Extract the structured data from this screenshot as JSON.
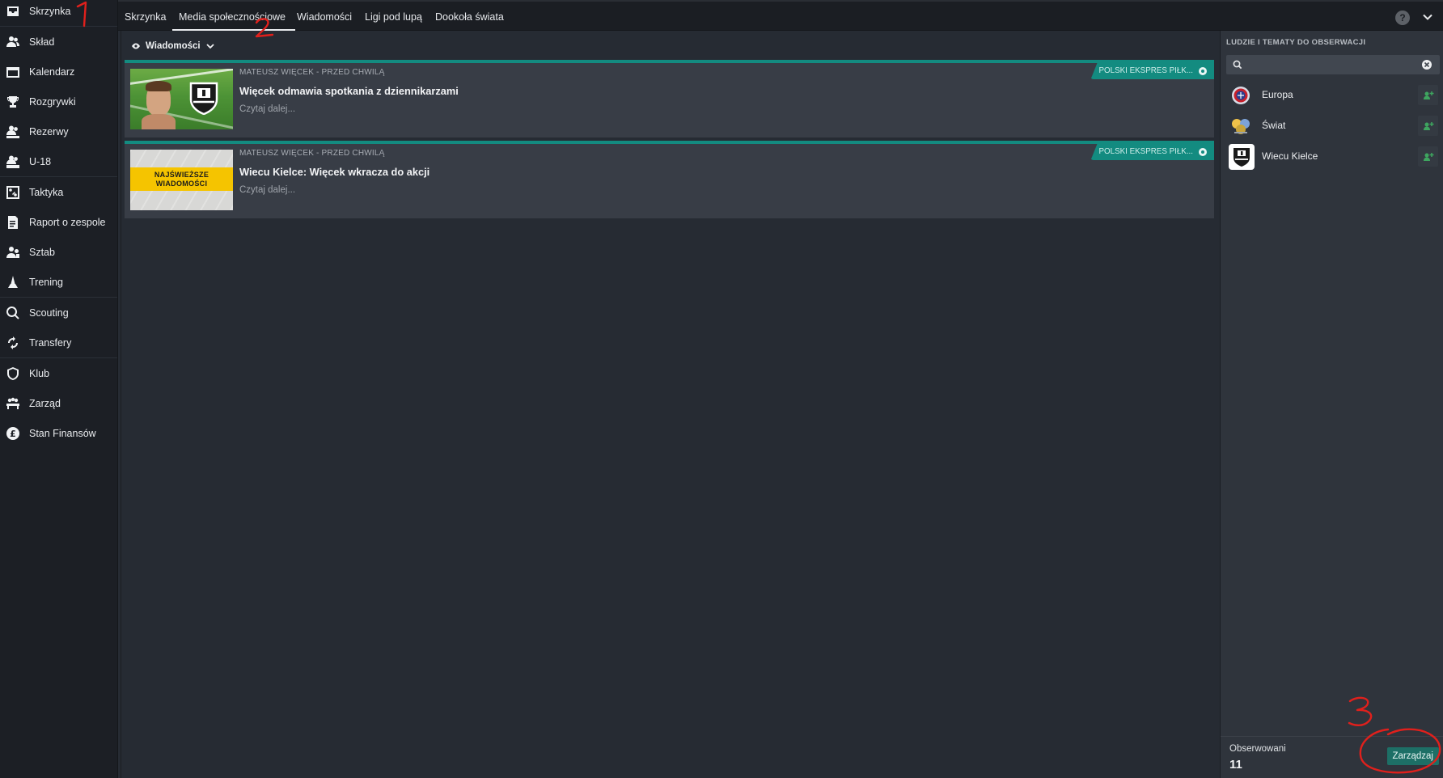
{
  "sidebar": {
    "items": [
      {
        "label": "Skrzynka",
        "icon": "inbox-icon"
      },
      {
        "label": "Skład",
        "icon": "squad-icon"
      },
      {
        "label": "Kalendarz",
        "icon": "calendar-icon"
      },
      {
        "label": "Rozgrywki",
        "icon": "trophy-icon"
      },
      {
        "label": "Rezerwy",
        "icon": "reserves-icon"
      },
      {
        "label": "U-18",
        "icon": "u18-icon"
      },
      {
        "label": "Taktyka",
        "icon": "tactics-icon"
      },
      {
        "label": "Raport o zespole",
        "icon": "team-report-icon"
      },
      {
        "label": "Sztab",
        "icon": "staff-icon"
      },
      {
        "label": "Trening",
        "icon": "training-icon"
      },
      {
        "label": "Scouting",
        "icon": "search-icon"
      },
      {
        "label": "Transfery",
        "icon": "transfers-icon"
      },
      {
        "label": "Klub",
        "icon": "club-icon"
      },
      {
        "label": "Zarząd",
        "icon": "board-icon"
      },
      {
        "label": "Stan Finansów",
        "icon": "finances-icon"
      }
    ]
  },
  "topbar": {
    "tabs": [
      {
        "label": "Skrzynka"
      },
      {
        "label": "Media społecznościowe"
      },
      {
        "label": "Wiadomości"
      },
      {
        "label": "Ligi pod lupą"
      },
      {
        "label": "Dookoła świata"
      }
    ],
    "active_tab": "Media społecznościowe",
    "help_label": "?"
  },
  "main": {
    "filter_label": "Wiadomości",
    "news": [
      {
        "meta": "MATEUSZ WIĘCEK - PRZED CHWILĄ",
        "title": "Więcek odmawia spotkania z dziennikarzami",
        "read_more": "Czytaj dalej...",
        "source": "POLSKI EKSPRES PIŁK...",
        "thumbnail": "player-face"
      },
      {
        "meta": "MATEUSZ WIĘCEK - PRZED CHWILĄ",
        "title": "Wiecu Kielce: Więcek wkracza do akcji",
        "read_more": "Czytaj dalej...",
        "source": "POLSKI EKSPRES PIŁK...",
        "thumbnail": "latest-news",
        "thumbnail_text_1": "NAJŚWIEŻSZE",
        "thumbnail_text_2": "WIADOMOŚCI"
      }
    ]
  },
  "right_panel": {
    "title": "LUDZIE I TEMATY DO OBSERWACJI",
    "search_placeholder": "",
    "follow_items": [
      {
        "name": "Europa",
        "logo": "uefa-logo"
      },
      {
        "name": "Świat",
        "logo": "world-logo"
      },
      {
        "name": "Wiecu Kielce",
        "logo": "club-crest-logo"
      }
    ],
    "followed_label": "Obserwowani",
    "followed_count": "11",
    "manage_label": "Zarządzaj"
  },
  "annotations": {
    "marks": [
      "1",
      "2",
      "3"
    ],
    "color": "#e0201c"
  },
  "colors": {
    "accent": "#138b80",
    "sidebar_bg": "#1c1f25",
    "main_bg": "#262b33",
    "card_bg": "#383d46"
  }
}
